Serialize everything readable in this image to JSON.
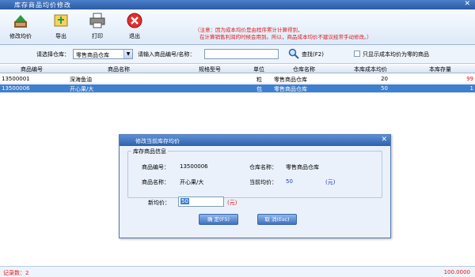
{
  "window": {
    "title": "库存商品均价修改",
    "close_glyph": "✕"
  },
  "toolbar": {
    "buttons": [
      {
        "label": "修改均价",
        "icon": "edit-price-icon"
      },
      {
        "label": "导出",
        "icon": "export-icon"
      },
      {
        "label": "打印",
        "icon": "printer-icon"
      },
      {
        "label": "退出",
        "icon": "exit-icon"
      }
    ],
    "note_line1": "（注意：因为成本均价是由程序累计计算得到，",
    "note_line2": "在计算销售利润的时候会用到。所以，商品成本均价不建议经常手动修改。）"
  },
  "filter": {
    "warehouse_label": "请选择仓库：",
    "warehouse_value": "零售商品仓库",
    "search_label": "请输入商品编号/名称：",
    "search_value": "",
    "search_button": "查找(F2)",
    "checkbox_label": "只显示成本均价为零的商品"
  },
  "grid": {
    "headers": [
      "商品编号",
      "商品名称",
      "规格型号",
      "单位",
      "仓库名称",
      "本库成本均价",
      "本库存量"
    ],
    "rows": [
      {
        "code": "13500001",
        "name": "深海鱼油",
        "spec": "",
        "unit": "粒",
        "warehouse": "零售商品仓库",
        "cost": "20",
        "qty": "99"
      },
      {
        "code": "13500006",
        "name": "开心果/大",
        "spec": "",
        "unit": "包",
        "warehouse": "零售商品仓库",
        "cost": "50",
        "qty": "1"
      }
    ]
  },
  "status": {
    "record_count": "记录数：2",
    "total": "100.0000"
  },
  "dialog": {
    "title": "修改当前库存均价",
    "close_glyph": "✕",
    "group_title": "库存商品信息",
    "code_label": "商品编号：",
    "code_value": "13500006",
    "warehouse_label": "仓库名称：",
    "warehouse_value": "零售商品仓库",
    "name_label": "商品名称：",
    "name_value": "开心果/大",
    "current_price_label": "当前均价：",
    "current_price_value": "50",
    "current_price_unit": "(元)",
    "new_price_label": "新均价：",
    "new_price_value": "50",
    "new_price_unit": "(元)",
    "ok_button": "确 定(F5)",
    "cancel_button": "取 消(Esc)"
  },
  "colors": {
    "accent": "#2e61ad",
    "selected_row": "#3d7fd0",
    "warning": "#e01818"
  }
}
